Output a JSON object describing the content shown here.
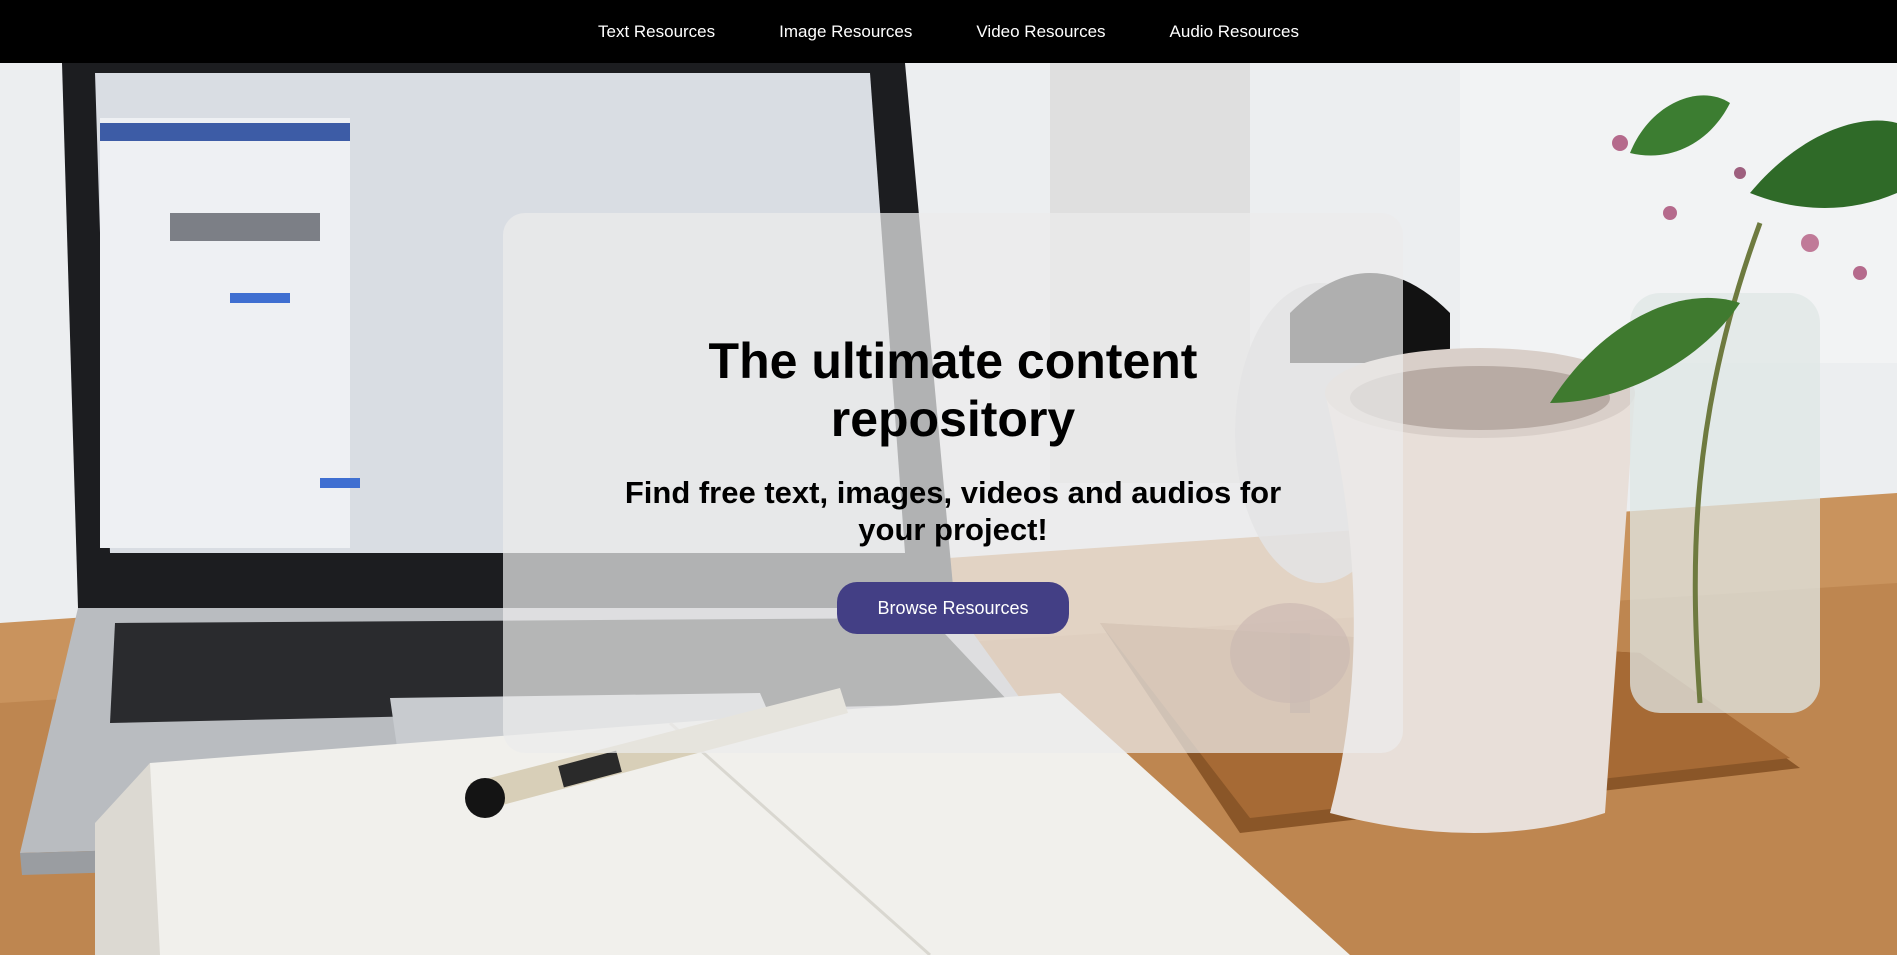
{
  "nav": {
    "items": [
      {
        "label": "Text Resources"
      },
      {
        "label": "Image Resources"
      },
      {
        "label": "Video Resources"
      },
      {
        "label": "Audio Resources"
      }
    ]
  },
  "hero": {
    "title": "The ultimate content repository",
    "subtitle": "Find free text, images, videos and audios for your project!",
    "cta_label": "Browse Resources"
  },
  "colors": {
    "nav_background": "#000000",
    "nav_text": "#ffffff",
    "cta_background": "#433f85",
    "cta_text": "#ffffff"
  }
}
